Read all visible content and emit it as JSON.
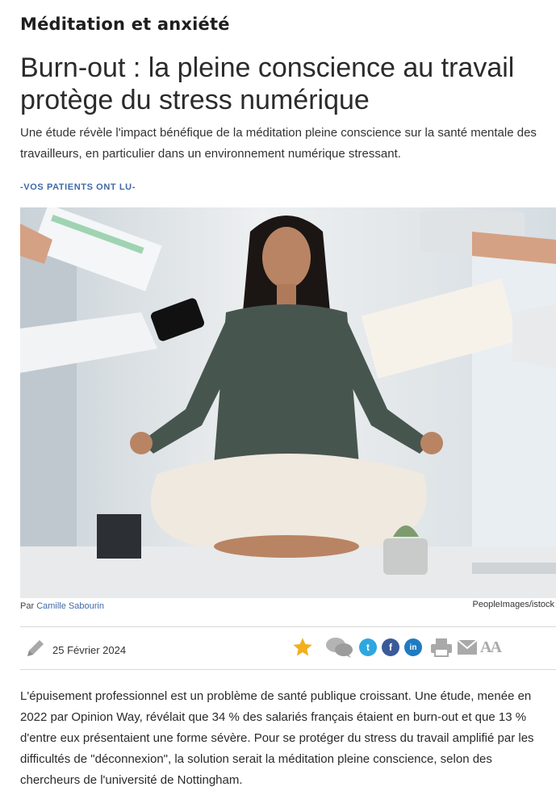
{
  "category": "Méditation et anxiété",
  "headline": "Burn-out : la pleine conscience au travail protège du stress numérique",
  "intro": "Une étude révèle l'impact bénéfique de la méditation pleine conscience sur la santé mentale des travailleurs, en particulier dans un environnement numérique stressant.",
  "section_tag": "-VOS PATIENTS ONT LU-",
  "byline": {
    "prefix": "Par",
    "author": "Camille Sabourin"
  },
  "photo_credit": "PeopleImages/istock",
  "toolbar": {
    "date": "25 Février 2024",
    "icons": [
      "pencil-icon",
      "star-icon",
      "comments-icon",
      "twitter-icon",
      "facebook-icon",
      "linkedin-icon",
      "print-icon",
      "email-icon",
      "font-size-icon"
    ],
    "twitter_glyph": "t",
    "facebook_glyph": "f",
    "linkedin_glyph": "in",
    "font_size_glyph": "AA"
  },
  "body": "L'épuisement professionnel est un problème de santé publique croissant. Une étude, menée en 2022 par Opinion Way, révélait que 34 % des salariés français étaient en burn-out et que 13 % d'entre eux présentaient une forme sévère. Pour se protéger du stress du travail amplifié par les difficultés de \"déconnexion\", la solution serait la méditation pleine conscience, selon des chercheurs de l'université de Nottingham.",
  "colors": {
    "link": "#3f6aa6",
    "star": "#f2b01e",
    "twitter": "#2ea7e0",
    "facebook": "#3b5a9a",
    "linkedin": "#1f7bc1",
    "gray_icon": "#a9a9a9"
  }
}
